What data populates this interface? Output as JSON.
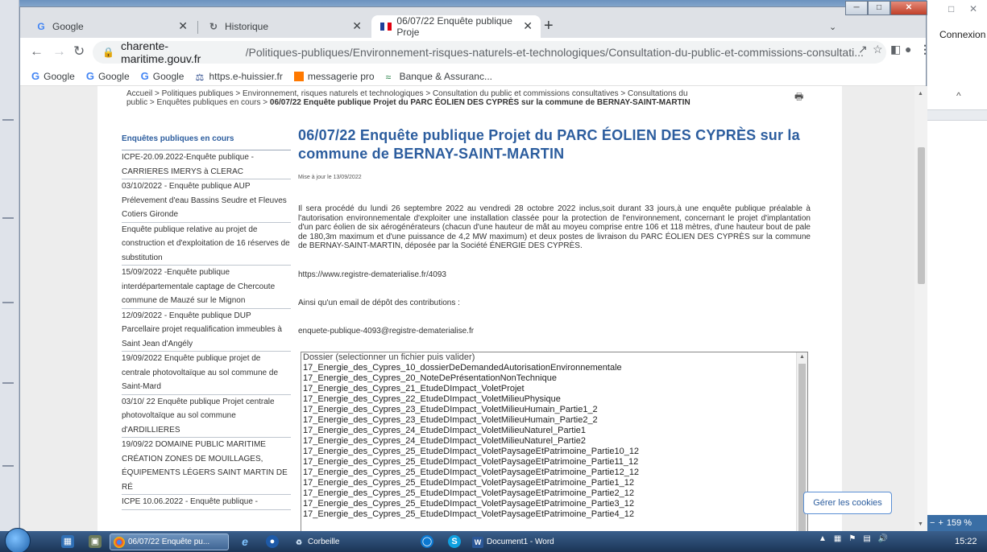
{
  "browser": {
    "tabs": [
      {
        "label": "Google",
        "favicon": "google-icon"
      },
      {
        "label": "Historique",
        "favicon": "history-icon"
      },
      {
        "label": "06/07/22 Enquête publique Proje",
        "favicon": "france-flag-icon",
        "active": true
      }
    ],
    "url_domain": "charente-maritime.gouv.fr",
    "url_path": "/Politiques-publiques/Environnement-risques-naturels-et-technologiques/Consultation-du-public-et-commissions-consultati...",
    "bookmarks": [
      {
        "label": "Google",
        "icon": "google-icon"
      },
      {
        "label": "Google",
        "icon": "google-icon"
      },
      {
        "label": "Google",
        "icon": "google-icon"
      },
      {
        "label": "https.e-huissier.fr",
        "icon": "huissier-icon"
      },
      {
        "label": "messagerie pro",
        "icon": "mail-icon"
      },
      {
        "label": "Banque & Assuranc...",
        "icon": "bank-icon"
      }
    ]
  },
  "page": {
    "breadcrumb_plain": "Accueil > Politiques publiques > Environnement, risques naturels et technologiques > Consultation du public et commissions consultatives > Consultations du public > Enquêtes publiques en cours > ",
    "breadcrumb_bold": "06/07/22 Enquête publique Projet du PARC ÉOLIEN DES CYPRÈS sur la commune de BERNAY-SAINT-MARTIN",
    "sidebar_title": "Enquêtes publiques en cours",
    "sidebar_items": [
      "ICPE-20.09.2022-Enquête publique - CARRIERES IMERYS à CLERAC",
      "03/10/2022 - Enquête publique AUP Prélevement d'eau Bassins Seudre et Fleuves Cotiers Gironde",
      "Enquête publique relative au projet de construction et d'exploitation de 16 réserves de substitution",
      "15/09/2022 -Enquête publique interdépartementale captage de Chercoute commune de Mauzé sur le Mignon",
      "12/09/2022 - Enquête publique DUP Parcellaire projet requalification immeubles à Saint Jean d'Angély",
      "19/09/2022 Enquête publique projet de centrale photovoltaïque au sol commune de Saint-Mard",
      "03/10/ 22 Enquête publique Projet centrale photovoltaïque au sol commune d'ARDILLIERES",
      "19/09/22 DOMAINE PUBLIC MARITIME CRÉATION ZONES DE MOUILLAGES, ÉQUIPEMENTS LÉGERS SAINT MARTIN DE RÉ",
      "ICPE 10.06.2022 - Enquête publique -"
    ],
    "title": "06/07/22 Enquête publique Projet du PARC ÉOLIEN DES CYPRÈS sur la commune de BERNAY-SAINT-MARTIN",
    "updated": "Mise à jour le 13/09/2022",
    "body": "Il sera procédé du lundi 26 septembre 2022 au vendredi 28 octobre 2022 inclus,soit durant 33 jours,à une enquête publique préalable à l'autorisation environnementale d'exploiter une installation classée pour la protection de l'environnement, concernant le projet d'implantation d'un parc éolien de six aérogénérateurs (chacun d'une hauteur de mât au moyeu comprise entre 106 et 118 mètres, d'une hauteur bout de pale de 180,3m maximum et d'une puissance de 4,2 MW maximum) et deux postes de livraison du PARC ÉOLIEN DES CYPRÈS sur la commune de BERNAY-SAINT-MARTIN, déposée par la Société ÉNERGIE DES CYPRÈS.",
    "registry_url": "https://www.registre-dematerialise.fr/4093",
    "email_intro": "Ainsi qu'un email de dépôt des contributions :",
    "email": "enquete-publique-4093@registre-dematerialise.fr",
    "dossier_placeholder": "Dossier (selectionner un fichier puis valider)",
    "dossier_files": [
      "17_Energie_des_Cypres_10_dossierDeDemandedAutorisationEnvironnementale",
      "17_Energie_des_Cypres_20_NoteDePrésentationNonTechnique",
      "17_Energie_des_Cypres_21_EtudeDImpact_VoletProjet",
      "17_Energie_des_Cypres_22_EtudeDImpact_VoletMilieuPhysique",
      "17_Energie_des_Cypres_23_EtudeDImpact_VoletMilieuHumain_Partie1_2",
      "17_Energie_des_Cypres_23_EtudeDImpact_VoletMilieuHumain_Partie2_2",
      "17_Energie_des_Cypres_24_EtudeDImpact_VoletMilieuNaturel_Partie1",
      "17_Energie_des_Cypres_24_EtudeDImpact_VoletMilieuNaturel_Partie2",
      "17_Energie_des_Cypres_25_EtudeDImpact_VoletPaysageEtPatrimoine_Partie10_12",
      "17_Energie_des_Cypres_25_EtudeDImpact_VoletPaysageEtPatrimoine_Partie11_12",
      "17_Energie_des_Cypres_25_EtudeDImpact_VoletPaysageEtPatrimoine_Partie12_12",
      "17_Energie_des_Cypres_25_EtudeDImpact_VoletPaysageEtPatrimoine_Partie1_12",
      "17_Energie_des_Cypres_25_EtudeDImpact_VoletPaysageEtPatrimoine_Partie2_12",
      "17_Energie_des_Cypres_25_EtudeDImpact_VoletPaysageEtPatrimoine_Partie3_12",
      "17_Energie_des_Cypres_25_EtudeDImpact_VoletPaysageEtPatrimoine_Partie4_12"
    ],
    "cookies_button": "Gérer les cookies"
  },
  "background_app": {
    "connexion": "Connexion",
    "zoom": "159 %"
  },
  "taskbar": {
    "chrome_label": "06/07/22 Enquête pu...",
    "recycle_label": "Corbeille",
    "word_label": "Document1 - Word",
    "clock": "15:22"
  },
  "colors": {
    "accent": "#2c5d9e",
    "taskbar": "#1b3556"
  }
}
